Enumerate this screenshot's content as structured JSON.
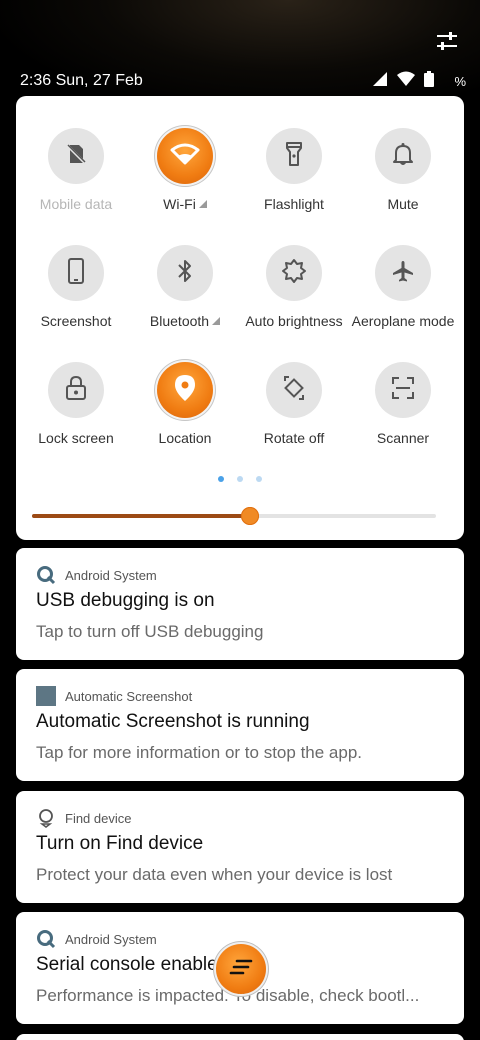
{
  "status_bar": {
    "time_date": "2:36 Sun, 27 Feb",
    "battery_percent": "%",
    "icons": [
      "signal-icon",
      "wifi-icon",
      "battery-icon"
    ]
  },
  "header": {
    "settings_icon": "sliders-icon"
  },
  "quick_settings": {
    "tiles": [
      {
        "label": "Mobile data",
        "icon": "no-sim-icon",
        "active": false,
        "disabled": true
      },
      {
        "label": "Wi-Fi",
        "icon": "wifi-icon",
        "active": true,
        "has_signal": true
      },
      {
        "label": "Flashlight",
        "icon": "flashlight-icon",
        "active": false
      },
      {
        "label": "Mute",
        "icon": "bell-icon",
        "active": false
      },
      {
        "label": "Screenshot",
        "icon": "phone-icon",
        "active": false
      },
      {
        "label": "Bluetooth",
        "icon": "bluetooth-icon",
        "active": false,
        "has_signal": true
      },
      {
        "label": "Auto brightness",
        "icon": "brightness-icon",
        "active": false
      },
      {
        "label": "Aeroplane mode",
        "icon": "airplane-icon",
        "active": false
      },
      {
        "label": "Lock screen",
        "icon": "lock-icon",
        "active": false
      },
      {
        "label": "Location",
        "icon": "location-pin-icon",
        "active": true
      },
      {
        "label": "Rotate off",
        "icon": "rotate-icon",
        "active": false
      },
      {
        "label": "Scanner",
        "icon": "scan-icon",
        "active": false
      }
    ],
    "page_count": 3,
    "current_page": 1,
    "brightness_level": 0.54
  },
  "notifications": [
    {
      "app": "Android System",
      "app_icon": "android-system-icon",
      "title": "USB debugging is on",
      "body": "Tap to turn off USB debugging"
    },
    {
      "app": "Automatic Screenshot",
      "app_icon": "app-square-icon",
      "title": "Automatic Screenshot is running",
      "body": "Tap for more information or to stop the app."
    },
    {
      "app": "Find device",
      "app_icon": "find-device-icon",
      "title": "Turn on Find device",
      "body": "Protect your data even when your device is lost"
    },
    {
      "app": "Android System",
      "app_icon": "android-system-icon",
      "title": "Serial console enabled",
      "body": "Performance is impacted. To disable, check bootl..."
    }
  ],
  "colors": {
    "accent": "#f07c12",
    "slider_fill": "#9c4a15",
    "page_dot_active": "#4aa1e8",
    "page_dot_inactive": "#bcd9f2",
    "panel_bg": "#ffffff",
    "background": "#000000"
  }
}
